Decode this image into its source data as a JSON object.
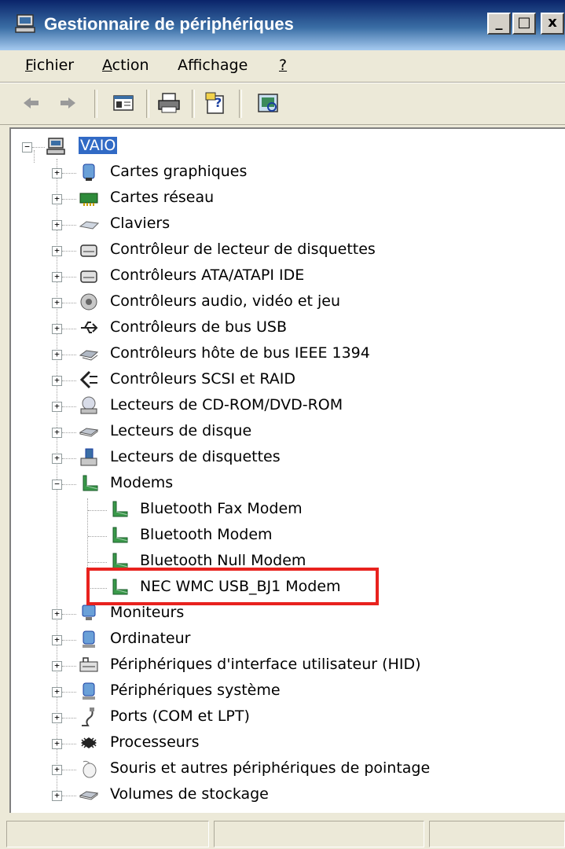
{
  "window": {
    "title": "Gestionnaire de périphériques",
    "minimize_glyph": "_",
    "maximize_glyph": "□",
    "close_glyph": "x"
  },
  "menu": {
    "items": [
      {
        "label": "Fichier",
        "accel": "F",
        "rest": "ichier"
      },
      {
        "label": "Action",
        "accel": "A",
        "rest": "ction"
      },
      {
        "label": "Affichage",
        "pre": "Aff",
        "accel": "i",
        "rest": "chage"
      },
      {
        "label": "?",
        "accel": "?",
        "rest": ""
      }
    ]
  },
  "toolbar": {
    "buttons": [
      "back-icon",
      "forward-icon",
      "show-hide-tree-icon",
      "print-icon",
      "help-properties-icon",
      "scan-hardware-icon"
    ]
  },
  "tree": {
    "root": {
      "label": "VAIO",
      "icon": "computer-icon",
      "expanded": true,
      "selected": true
    },
    "categories": [
      {
        "label": "Cartes graphiques",
        "icon": "display-adapter-icon",
        "expanded": false
      },
      {
        "label": "Cartes réseau",
        "icon": "network-card-icon",
        "expanded": false
      },
      {
        "label": "Claviers",
        "icon": "keyboard-icon",
        "expanded": false
      },
      {
        "label": "Contrôleur de lecteur de disquettes",
        "icon": "floppy-controller-icon",
        "expanded": false
      },
      {
        "label": "Contrôleurs ATA/ATAPI IDE",
        "icon": "ide-controller-icon",
        "expanded": false
      },
      {
        "label": "Contrôleurs audio, vidéo et jeu",
        "icon": "audio-icon",
        "expanded": false
      },
      {
        "label": "Contrôleurs de bus USB",
        "icon": "usb-icon",
        "expanded": false
      },
      {
        "label": "Contrôleurs hôte de bus IEEE 1394",
        "icon": "firewire-icon",
        "expanded": false
      },
      {
        "label": "Contrôleurs SCSI et RAID",
        "icon": "scsi-icon",
        "expanded": false
      },
      {
        "label": "Lecteurs de CD-ROM/DVD-ROM",
        "icon": "cdrom-icon",
        "expanded": false
      },
      {
        "label": "Lecteurs de disque",
        "icon": "disk-drive-icon",
        "expanded": false
      },
      {
        "label": "Lecteurs de disquettes",
        "icon": "floppy-drive-icon",
        "expanded": false
      },
      {
        "label": "Modems",
        "icon": "modem-icon",
        "expanded": true,
        "children": [
          {
            "label": "Bluetooth Fax Modem",
            "icon": "modem-icon"
          },
          {
            "label": "Bluetooth Modem",
            "icon": "modem-icon"
          },
          {
            "label": "Bluetooth Null Modem",
            "icon": "modem-icon"
          },
          {
            "label": "NEC WMC USB_BJ1 Modem",
            "icon": "modem-icon",
            "highlighted": true
          }
        ]
      },
      {
        "label": "Moniteurs",
        "icon": "monitor-icon",
        "expanded": false
      },
      {
        "label": "Ordinateur",
        "icon": "computer-icon",
        "expanded": false
      },
      {
        "label": "Périphériques d'interface utilisateur (HID)",
        "icon": "hid-icon",
        "expanded": false
      },
      {
        "label": "Périphériques système",
        "icon": "system-device-icon",
        "expanded": false
      },
      {
        "label": "Ports (COM et LPT)",
        "icon": "port-icon",
        "expanded": false
      },
      {
        "label": "Processeurs",
        "icon": "processor-icon",
        "expanded": false
      },
      {
        "label": "Souris et autres périphériques de pointage",
        "icon": "mouse-icon",
        "expanded": false
      },
      {
        "label": "Volumes de stockage",
        "icon": "storage-volume-icon",
        "expanded": false
      }
    ]
  },
  "colors": {
    "title_gradient_start": "#0a246a",
    "title_gradient_end": "#a6caf0",
    "selection": "#316ac5",
    "highlight_border": "#e8221e"
  }
}
